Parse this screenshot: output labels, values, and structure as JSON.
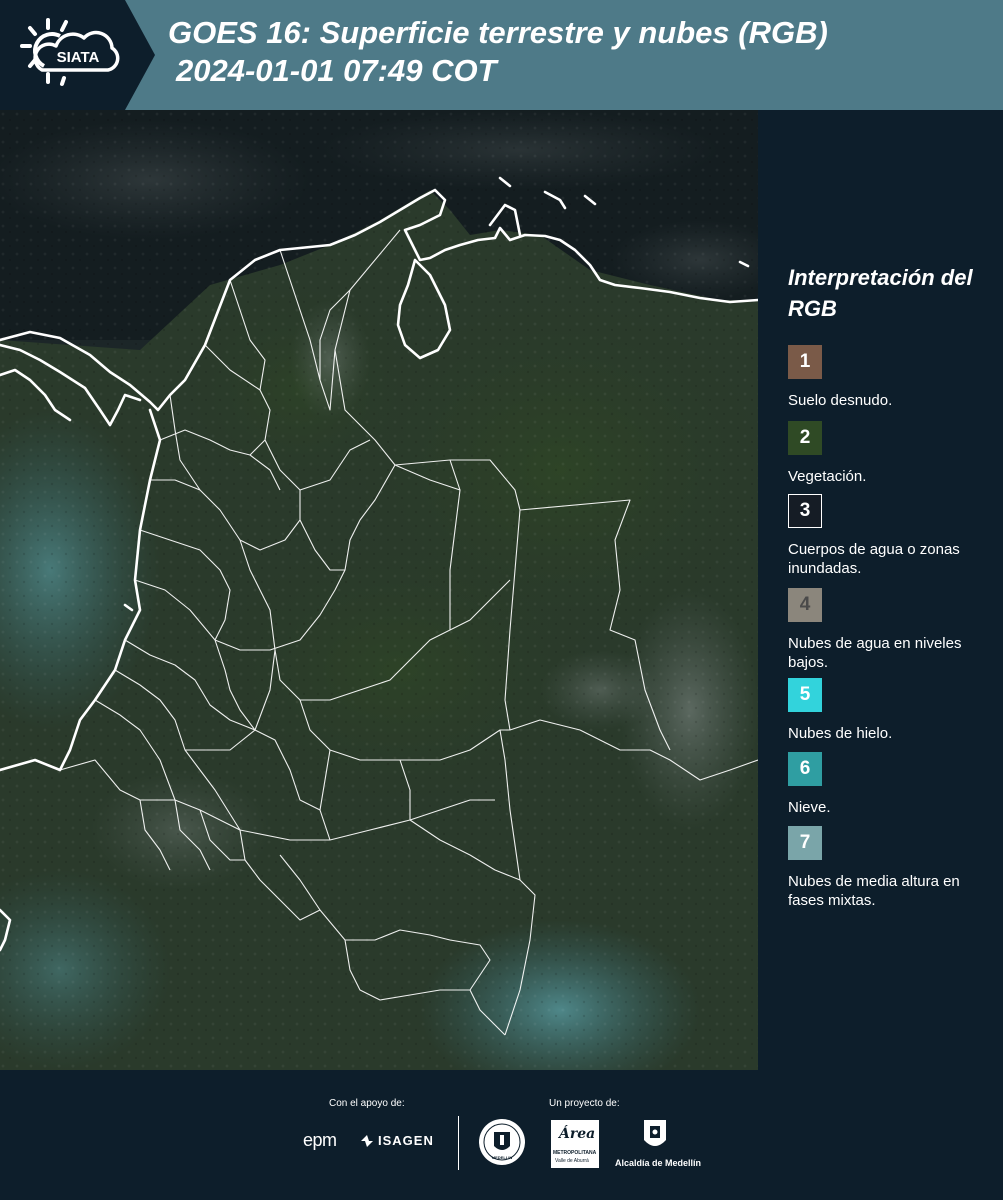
{
  "header": {
    "logo_text": "SIATA",
    "title_line1": "GOES 16: Superficie terrestre y nubes (RGB)",
    "title_line2": "2024-01-01 07:49 COT"
  },
  "legend": {
    "title": "Interpretación del RGB",
    "items": [
      {
        "number": "1",
        "label": "Suelo desnudo.",
        "color": "#7a5a48"
      },
      {
        "number": "2",
        "label": "Vegetación.",
        "color": "#2f4a25"
      },
      {
        "number": "3",
        "label": "Cuerpos de agua o zonas inundadas.",
        "color": "#151c25"
      },
      {
        "number": "4",
        "label": "Nubes de agua en niveles bajos.",
        "color": "#8b867c"
      },
      {
        "number": "5",
        "label": "Nubes de hielo.",
        "color": "#32d3dc"
      },
      {
        "number": "6",
        "label": "Nieve.",
        "color": "#2f9ea2"
      },
      {
        "number": "7",
        "label": "Nubes de media altura en fases mixtas.",
        "color": "#7aa5a9"
      }
    ]
  },
  "footer": {
    "support_caption": "Con el apoyo de:",
    "project_caption": "Un proyecto de:",
    "epm": "epm",
    "isagen": "ISAGEN",
    "medellin_seal": "MEDELLIN",
    "area_metro_script": "Área",
    "area_metro_line1": "METROPOLITANA",
    "area_metro_line2": "Valle de Aburrá",
    "alcaldia": "Alcaldía de Medellín"
  },
  "colors": {
    "header_bg": "#4e7a88",
    "panel_bg": "#0d1e2b",
    "map_bg": "#1a2527"
  }
}
